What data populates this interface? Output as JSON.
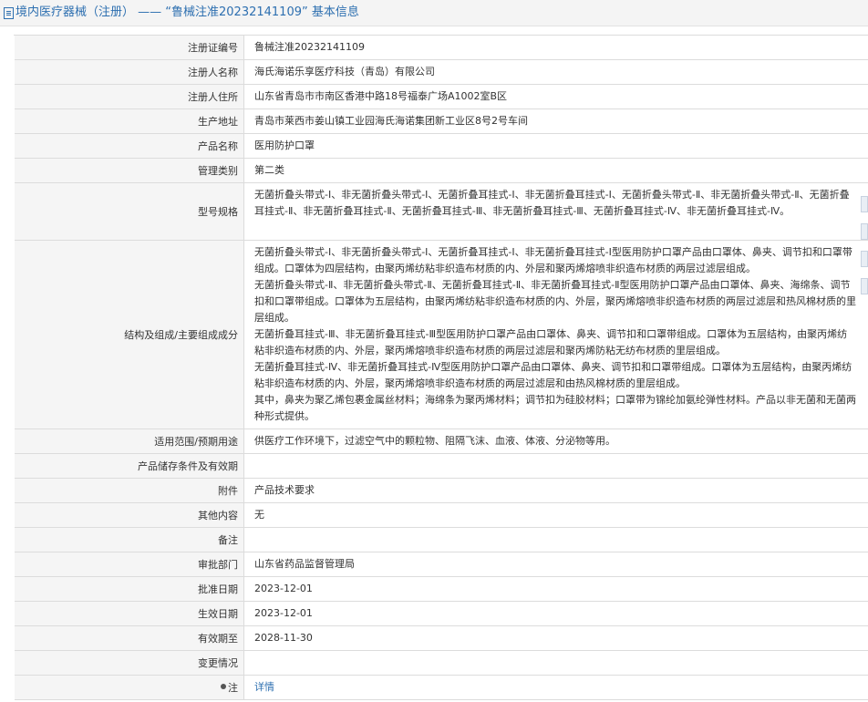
{
  "header": {
    "title": "境内医疗器械（注册） —— “鲁械注准20232141109” 基本信息"
  },
  "rows": [
    {
      "label": "注册证编号",
      "value": "鲁械注准20232141109"
    },
    {
      "label": "注册人名称",
      "value": "海氏海诺乐享医疗科技（青岛）有限公司"
    },
    {
      "label": "注册人住所",
      "value": "山东省青岛市市南区香港中路18号福泰广场A1002室B区"
    },
    {
      "label": "生产地址",
      "value": "青岛市莱西市姜山镇工业园海氏海诺集团新工业区8号2号车间"
    },
    {
      "label": "产品名称",
      "value": "医用防护口罩"
    },
    {
      "label": "管理类别",
      "value": "第二类"
    },
    {
      "label": "型号规格",
      "value": "无菌折叠头带式-Ⅰ、非无菌折叠头带式-Ⅰ、无菌折叠耳挂式-Ⅰ、非无菌折叠耳挂式-Ⅰ、无菌折叠头带式-Ⅱ、非无菌折叠头带式-Ⅱ、无菌折叠耳挂式-Ⅱ、非无菌折叠耳挂式-Ⅱ、无菌折叠耳挂式-Ⅲ、非无菌折叠耳挂式-Ⅲ、无菌折叠耳挂式-Ⅳ、非无菌折叠耳挂式-Ⅳ。"
    },
    {
      "label": "结构及组成/主要组成成分",
      "paragraphs": [
        "无菌折叠头带式-Ⅰ、非无菌折叠头带式-Ⅰ、无菌折叠耳挂式-Ⅰ、非无菌折叠耳挂式-Ⅰ型医用防护口罩产品由口罩体、鼻夹、调节扣和口罩带组成。口罩体为四层结构，由聚丙烯纺粘非织造布材质的内、外层和聚丙烯熔喷非织造布材质的两层过滤层组成。",
        "无菌折叠头带式-Ⅱ、非无菌折叠头带式-Ⅱ、无菌折叠耳挂式-Ⅱ、非无菌折叠耳挂式-Ⅱ型医用防护口罩产品由口罩体、鼻夹、海绵条、调节扣和口罩带组成。口罩体为五层结构，由聚丙烯纺粘非织造布材质的内、外层，聚丙烯熔喷非织造布材质的两层过滤层和热风棉材质的里层组成。",
        "无菌折叠耳挂式-Ⅲ、非无菌折叠耳挂式-Ⅲ型医用防护口罩产品由口罩体、鼻夹、调节扣和口罩带组成。口罩体为五层结构，由聚丙烯纺粘非织造布材质的内、外层，聚丙烯熔喷非织造布材质的两层过滤层和聚丙烯防粘无纺布材质的里层组成。",
        "无菌折叠耳挂式-Ⅳ、非无菌折叠耳挂式-Ⅳ型医用防护口罩产品由口罩体、鼻夹、调节扣和口罩带组成。口罩体为五层结构，由聚丙烯纺粘非织造布材质的内、外层，聚丙烯熔喷非织造布材质的两层过滤层和由热风棉材质的里层组成。",
        "其中，鼻夹为聚乙烯包裹金属丝材料；海绵条为聚丙烯材料；调节扣为硅胶材料；口罩带为锦纶加氨纶弹性材料。产品以非无菌和无菌两种形式提供。"
      ]
    },
    {
      "label": "适用范围/预期用途",
      "value": "供医疗工作环境下，过滤空气中的颗粒物、阻隔飞沫、血液、体液、分泌物等用。"
    },
    {
      "label": "产品储存条件及有效期",
      "value": ""
    },
    {
      "label": "附件",
      "value": "产品技术要求"
    },
    {
      "label": "其他内容",
      "value": "无"
    },
    {
      "label": "备注",
      "value": ""
    },
    {
      "label": "审批部门",
      "value": "山东省药品监督管理局"
    },
    {
      "label": "批准日期",
      "value": "2023-12-01"
    },
    {
      "label": "生效日期",
      "value": "2023-12-01"
    },
    {
      "label": "有效期至",
      "value": "2028-11-30"
    },
    {
      "label": "变更情况",
      "value": ""
    },
    {
      "label": "注",
      "value": "详情"
    }
  ]
}
